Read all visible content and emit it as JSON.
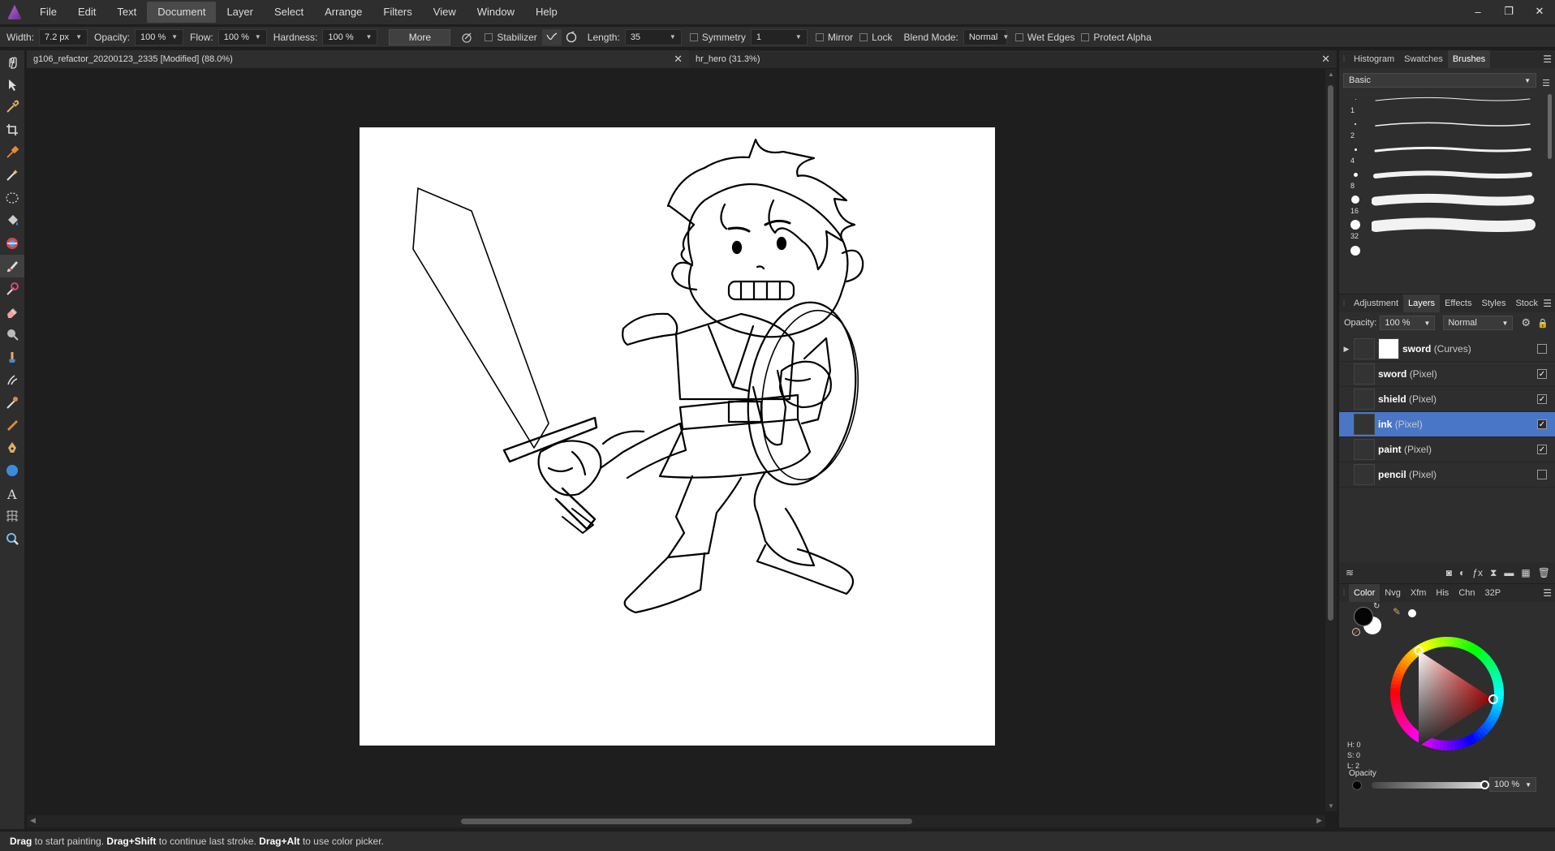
{
  "menu": {
    "items": [
      "File",
      "Edit",
      "Text",
      "Document",
      "Layer",
      "Select",
      "Arrange",
      "Filters",
      "View",
      "Window",
      "Help"
    ],
    "active_index": 3
  },
  "window_controls": {
    "minimize": "–",
    "restore": "❐",
    "close": "✕"
  },
  "context_toolbar": {
    "width_label": "Width:",
    "width_value": "7.2 px",
    "opacity_label": "Opacity:",
    "opacity_value": "100 %",
    "flow_label": "Flow:",
    "flow_value": "100 %",
    "hardness_label": "Hardness:",
    "hardness_value": "100 %",
    "more_label": "More",
    "stabilizer_label": "Stabilizer",
    "stabilizer_checked": false,
    "length_label": "Length:",
    "length_value": "35",
    "symmetry_label": "Symmetry",
    "symmetry_value": "1",
    "symmetry_checked": false,
    "mirror_label": "Mirror",
    "mirror_checked": false,
    "lock_label": "Lock",
    "lock_checked": false,
    "blend_label": "Blend Mode:",
    "blend_value": "Normal",
    "wet_edges_label": "Wet Edges",
    "wet_edges_checked": false,
    "protect_alpha_label": "Protect Alpha",
    "protect_alpha_checked": false
  },
  "tools": [
    {
      "name": "view-tool-icon",
      "active": false
    },
    {
      "name": "move-tool-icon",
      "active": false
    },
    {
      "name": "color-picker-tool-icon",
      "active": false
    },
    {
      "name": "crop-tool-icon",
      "active": false
    },
    {
      "name": "selection-brush-tool-icon",
      "active": false
    },
    {
      "name": "magic-wand-tool-icon",
      "active": false
    },
    {
      "name": "marquee-tool-icon",
      "active": false
    },
    {
      "name": "flood-fill-tool-icon",
      "active": false
    },
    {
      "name": "gradient-tool-icon",
      "active": false
    },
    {
      "name": "paint-brush-tool-icon",
      "active": true
    },
    {
      "name": "color-replacement-tool-icon",
      "active": false
    },
    {
      "name": "erase-brush-tool-icon",
      "active": false
    },
    {
      "name": "dodge-tool-icon",
      "active": false
    },
    {
      "name": "clone-tool-icon",
      "active": false
    },
    {
      "name": "smudge-tool-icon",
      "active": false
    },
    {
      "name": "blemish-tool-icon",
      "active": false
    },
    {
      "name": "red-eye-tool-icon",
      "active": false
    },
    {
      "name": "pen-tool-icon",
      "active": false
    },
    {
      "name": "shape-tool-icon",
      "active": false
    },
    {
      "name": "text-tool-icon",
      "active": false
    },
    {
      "name": "mesh-warp-tool-icon",
      "active": false
    },
    {
      "name": "zoom-tool-icon",
      "active": false
    }
  ],
  "document_tabs": [
    {
      "label": "g106_refactor_20200123_2335 [Modified] (88.0%)",
      "active": true
    },
    {
      "label": "hr_hero (31.3%)",
      "active": false
    }
  ],
  "panels": {
    "top_tabs": [
      "Histogram",
      "Swatches",
      "Brushes"
    ],
    "top_active": 2,
    "brush_category": "Basic",
    "brushes": [
      {
        "size": "1"
      },
      {
        "size": "2"
      },
      {
        "size": "4"
      },
      {
        "size": "8"
      },
      {
        "size": "16"
      },
      {
        "size": "32"
      }
    ],
    "middle_tabs": [
      "Adjustment",
      "Layers",
      "Effects",
      "Styles",
      "Stock"
    ],
    "middle_active": 1,
    "layer_opacity_label": "Opacity:",
    "layer_opacity_value": "100 %",
    "layer_blend_value": "Normal",
    "layers": [
      {
        "name": "sword",
        "type": "(Curves)",
        "visible": false,
        "selected": false,
        "expandable": true
      },
      {
        "name": "sword",
        "type": "(Pixel)",
        "visible": true,
        "selected": false,
        "expandable": false
      },
      {
        "name": "shield",
        "type": "(Pixel)",
        "visible": true,
        "selected": false,
        "expandable": false
      },
      {
        "name": "ink",
        "type": "(Pixel)",
        "visible": true,
        "selected": true,
        "expandable": false
      },
      {
        "name": "paint",
        "type": "(Pixel)",
        "visible": true,
        "selected": false,
        "expandable": false
      },
      {
        "name": "pencil",
        "type": "(Pixel)",
        "visible": false,
        "selected": false,
        "expandable": false
      }
    ],
    "bottom_tabs": [
      "Color",
      "Nvg",
      "Xfm",
      "His",
      "Chn",
      "32P"
    ],
    "bottom_active": 0,
    "color_readout": {
      "h": "H: 0",
      "s": "S: 0",
      "l": "L: 2"
    },
    "opacity_label": "Opacity",
    "opacity_value": "100 %",
    "opacity_fraction": 1.0
  },
  "status": {
    "k1": "Drag",
    "t1": " to start painting. ",
    "k2": "Drag+Shift",
    "t2": " to continue last stroke. ",
    "k3": "Drag+Alt",
    "t3": " to use color picker."
  }
}
